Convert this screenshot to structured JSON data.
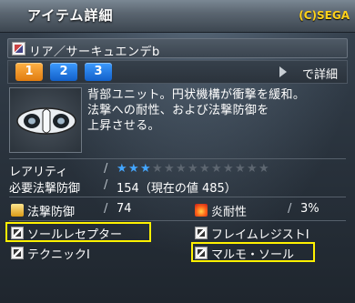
{
  "header": {
    "title": "アイテム詳細",
    "copyright": "(C)SEGA"
  },
  "item": {
    "name": "リア／サーキュエンデb"
  },
  "tabs": [
    {
      "label": "1",
      "active": true
    },
    {
      "label": "2",
      "active": false
    },
    {
      "label": "3",
      "active": false
    }
  ],
  "detail_label": "で詳細",
  "description": [
    "背部ユニット。円状機構が衝撃を緩和。",
    "法撃への耐性、および法撃防御を",
    "上昇させる。"
  ],
  "rarity": {
    "label": "レアリティ",
    "stars_filled": 3,
    "stars_total": 13
  },
  "requirement": {
    "label": "必要法撃防御",
    "value": "154（現在の値 485）"
  },
  "stats": {
    "tech_def": {
      "label": "法撃防御",
      "value": "74"
    },
    "fire_res": {
      "label": "炎耐性",
      "value": "3%"
    }
  },
  "abilities": [
    "ソールレセプター",
    "フレイムレジストI",
    "テクニックI",
    "マルモ・ソール"
  ],
  "colors": {
    "highlight": "#fff100",
    "accent": "#ffd21a",
    "star_on": "#43a6ff"
  }
}
